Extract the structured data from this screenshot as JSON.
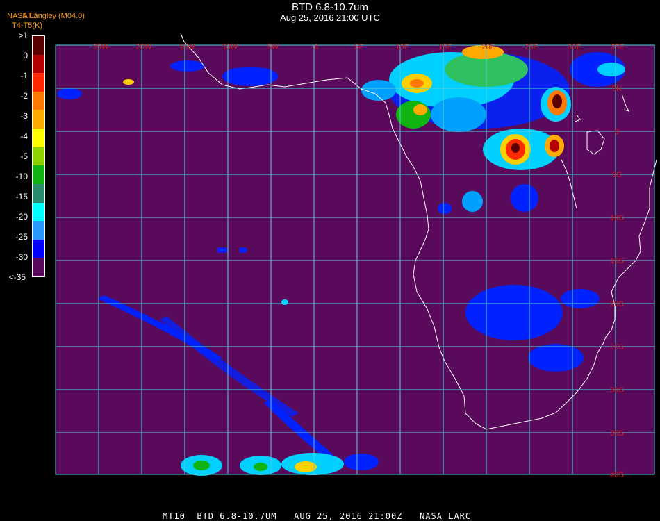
{
  "header": {
    "title": "BTD 6.8-10.7um",
    "datetime": "Aug 25, 2016 21:00 UTC",
    "credit": "NASA Langley (M04.0)",
    "overlap_label": "BTD",
    "units": "T4-T5(K)"
  },
  "legend": {
    "labels": [
      ">1",
      "0",
      "-1",
      "-2",
      "-3",
      "-4",
      "-5",
      "-10",
      "-15",
      "-20",
      "-25",
      "-30",
      "<-35"
    ],
    "colors": [
      "#5a0000",
      "#b40000",
      "#ff2a00",
      "#ff7800",
      "#ffaa00",
      "#ffff00",
      "#8cd200",
      "#10b410",
      "#2a8c6e",
      "#00ffff",
      "#2a96ff",
      "#0000ff",
      "#5a0a5a"
    ]
  },
  "map": {
    "background": "#5a0a5a",
    "grid_color": "#4fd1e0",
    "label_color": "#cc2020",
    "lon_labels": [
      "25W",
      "20W",
      "15W",
      "10W",
      "5W",
      "0",
      "5E",
      "10E",
      "15E",
      "20E",
      "25E",
      "30E",
      "35E"
    ],
    "lat_labels": [
      "5N",
      "0",
      "5S",
      "10S",
      "15S",
      "20S",
      "25S",
      "30S",
      "35S",
      "40S"
    ]
  },
  "footer": {
    "text": "MT10  BTD 6.8-10.7UM   AUG 25, 2016 21:00Z   NASA LARC"
  }
}
